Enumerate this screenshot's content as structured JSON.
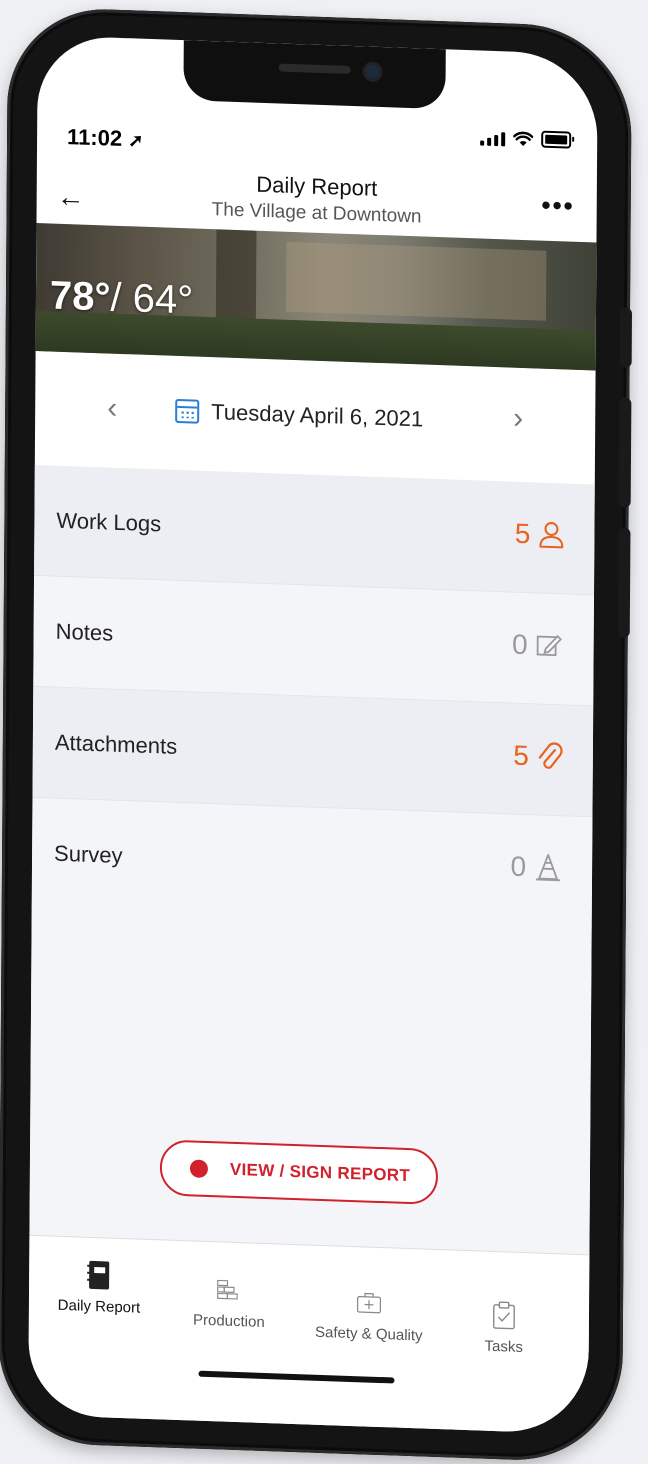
{
  "status_bar": {
    "time": "11:02"
  },
  "header": {
    "title": "Daily Report",
    "subtitle": "The Village at Downtown"
  },
  "weather": {
    "high": "78°",
    "low": "/ 64°"
  },
  "date_nav": {
    "date": "Tuesday April 6, 2021"
  },
  "sections": [
    {
      "label": "Work Logs",
      "count": "5",
      "icon": "user-icon",
      "accent": "#e8641e"
    },
    {
      "label": "Notes",
      "count": "0",
      "icon": "note-edit-icon",
      "accent": "#9a9a9a"
    },
    {
      "label": "Attachments",
      "count": "5",
      "icon": "paperclip-icon",
      "accent": "#e8641e"
    },
    {
      "label": "Survey",
      "count": "0",
      "icon": "traffic-cone-icon",
      "accent": "#9a9a9a"
    }
  ],
  "actions": {
    "sign_label": "VIEW / SIGN REPORT",
    "accent": "#d0212c"
  },
  "tabs": [
    {
      "label": "Daily Report",
      "icon": "notebook-icon",
      "active": true
    },
    {
      "label": "Production",
      "icon": "bricks-icon",
      "active": false
    },
    {
      "label": "Safety & Quality",
      "icon": "first-aid-kit-icon",
      "active": false
    },
    {
      "label": "Tasks",
      "icon": "clipboard-check-icon",
      "active": false
    }
  ],
  "colors": {
    "calendar_accent": "#2a7fd4",
    "orange": "#e8641e",
    "red": "#d0212c"
  }
}
